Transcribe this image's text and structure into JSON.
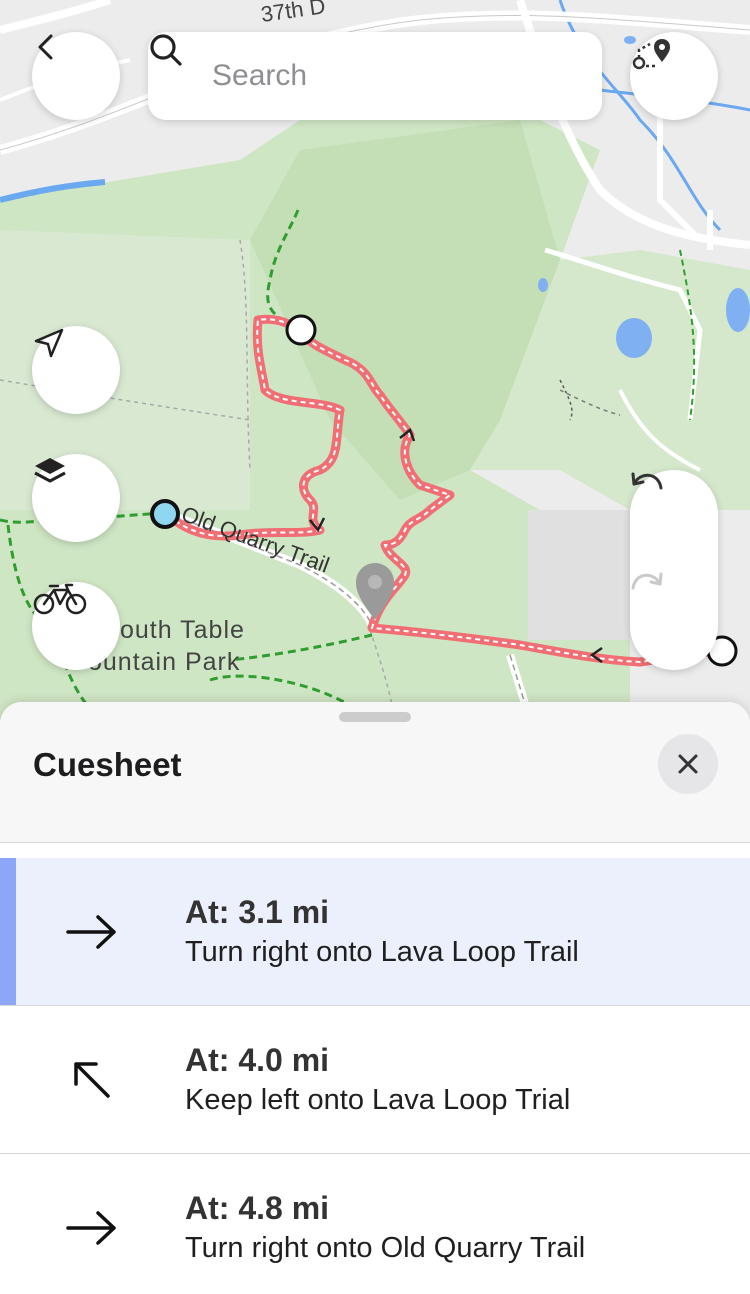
{
  "map": {
    "road_label_top": "37th D",
    "trail_label": "Old Quarry Trail",
    "park_label_line1": "outh Table",
    "park_label_line2": "ountain Park"
  },
  "search": {
    "placeholder": "Search",
    "value": ""
  },
  "cuesheet": {
    "title": "Cuesheet",
    "items": [
      {
        "distance": "At: 3.1 mi",
        "instruction": "Turn right onto Lava Loop Trail",
        "icon": "arrow-right-icon",
        "active": true
      },
      {
        "distance": "At: 4.0 mi",
        "instruction": "Keep left onto Lava Loop Trial",
        "icon": "arrow-up-left-icon",
        "active": false
      },
      {
        "distance": "At: 4.8 mi",
        "instruction": "Turn right onto Old Quarry Trail",
        "icon": "arrow-right-icon",
        "active": false
      }
    ]
  },
  "colors": {
    "route": "#f06e74",
    "trail_dashed": "#2f9e2f",
    "park_green": "#c8e2bd",
    "water": "#6aa8f0",
    "active_row_bg": "#ecf0fd",
    "active_row_bar": "#8ea6f7"
  }
}
